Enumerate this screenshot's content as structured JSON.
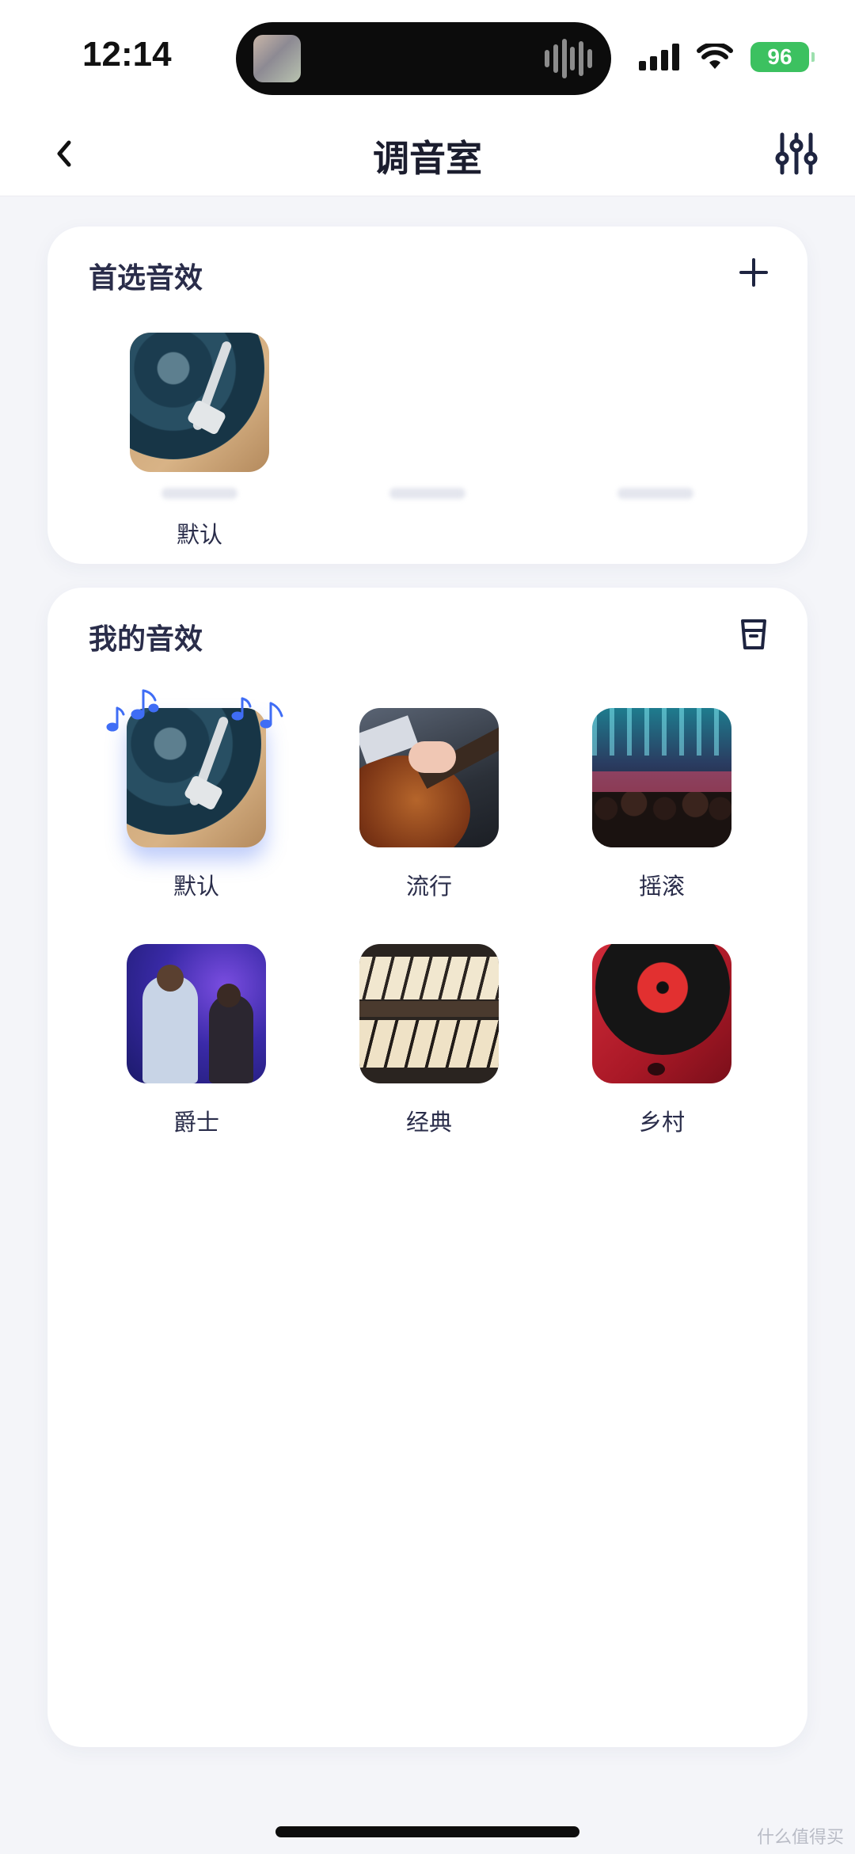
{
  "status_bar": {
    "time": "12:14",
    "battery": "96"
  },
  "nav": {
    "title": "调音室",
    "back_icon": "chevron-left-icon",
    "settings_icon": "equalizer-icon"
  },
  "preferred": {
    "title": "首选音效",
    "action_icon": "plus-icon",
    "items": [
      {
        "label": "默认",
        "art": "vinyl-turntable"
      }
    ]
  },
  "my_effects": {
    "title": "我的音效",
    "action_icon": "trash-icon",
    "selected_index": 0,
    "items": [
      {
        "label": "默认",
        "art": "vinyl-turntable"
      },
      {
        "label": "流行",
        "art": "electric-guitar"
      },
      {
        "label": "摇滚",
        "art": "concert-crowd"
      },
      {
        "label": "爵士",
        "art": "jazz-performers"
      },
      {
        "label": "经典",
        "art": "organ-keys"
      },
      {
        "label": "乡村",
        "art": "red-record-player"
      }
    ]
  },
  "watermark": "什么值得买",
  "colors": {
    "accent": "#3f6df5",
    "battery": "#3cc160",
    "background": "#f4f5f9"
  }
}
